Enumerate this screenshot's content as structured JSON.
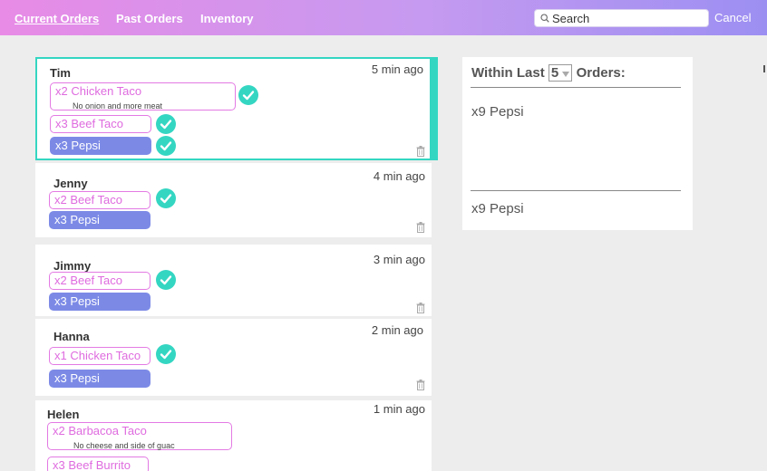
{
  "tabs": {
    "current": "Current Orders",
    "past": "Past Orders",
    "inventory": "Inventory"
  },
  "search": {
    "placeholder": "Search"
  },
  "cancel_label": "Cancel",
  "orders": [
    {
      "name": "Tim",
      "time": "5 min ago",
      "items": [
        {
          "text": "x2 Chicken Taco",
          "note": "No onion and more meat",
          "style": "outline",
          "checked": true
        },
        {
          "text": "x3 Beef Taco",
          "style": "outline",
          "checked": true
        },
        {
          "text": "x3 Pepsi",
          "style": "fill",
          "checked": true
        }
      ]
    },
    {
      "name": "Jenny",
      "time": "4 min ago",
      "items": [
        {
          "text": "x2 Beef Taco",
          "style": "outline",
          "checked": true
        },
        {
          "text": "x3 Pepsi",
          "style": "fill",
          "checked": false
        }
      ]
    },
    {
      "name": "Jimmy",
      "time": "3 min ago",
      "items": [
        {
          "text": "x2 Beef Taco",
          "style": "outline",
          "checked": true
        },
        {
          "text": "x3 Pepsi",
          "style": "fill",
          "checked": false
        }
      ]
    },
    {
      "name": "Hanna",
      "time": "2 min ago",
      "items": [
        {
          "text": "x1 Chicken Taco",
          "style": "outline",
          "checked": true
        },
        {
          "text": "x3 Pepsi",
          "style": "fill",
          "checked": false
        }
      ]
    },
    {
      "name": "Helen",
      "time": "1 min ago",
      "items": [
        {
          "text": "x2 Barbacoa Taco",
          "note": "No cheese and side of guac",
          "style": "outline",
          "checked": false
        },
        {
          "text": "x3 Beef Burrito",
          "style": "outline",
          "checked": false
        }
      ]
    }
  ],
  "summary": {
    "prefix": "Within Last",
    "count": "5",
    "suffix": "Orders:",
    "items": [
      "x9 Pepsi"
    ],
    "total": "x9 Pepsi"
  },
  "colors": {
    "accent": "#34d6c2",
    "outline_pill": "#e37ae3",
    "fill_pill": "#7c8ae6"
  },
  "icons": {
    "check": "check-circle-icon",
    "trash": "trash-icon",
    "search": "search-icon",
    "dropdown": "chevron-down-icon"
  }
}
